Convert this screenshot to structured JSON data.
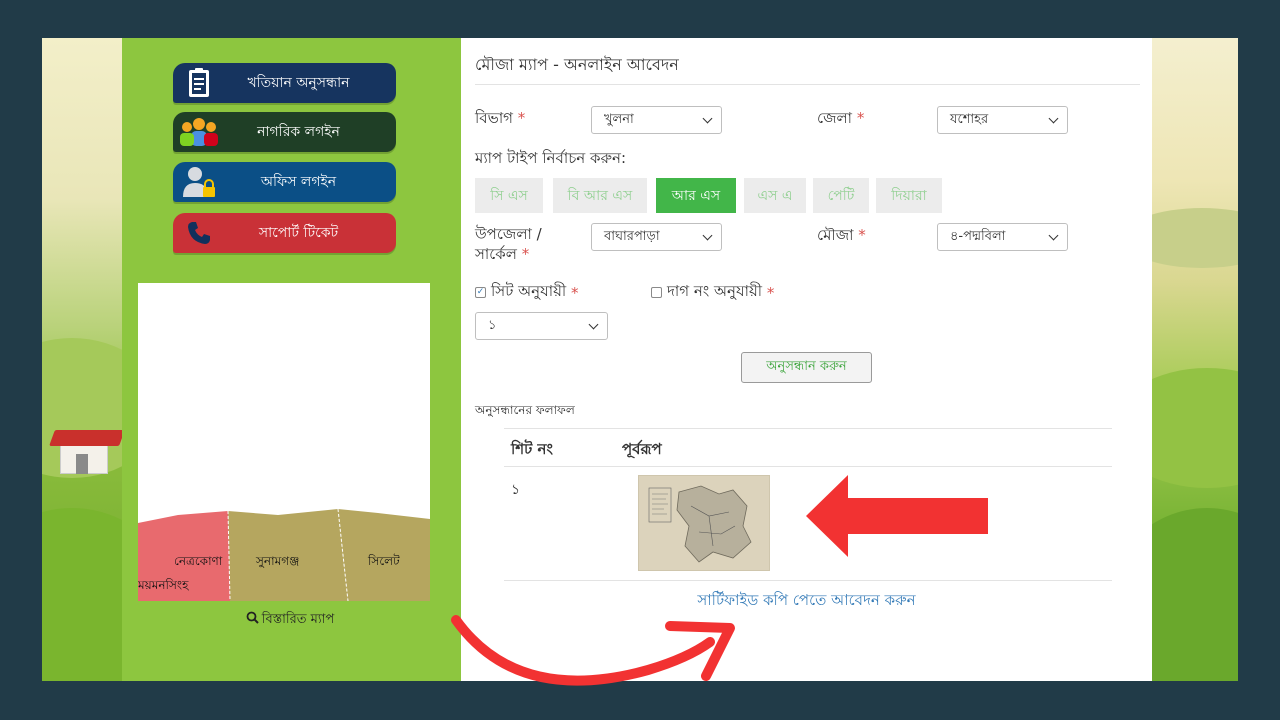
{
  "sidebar": {
    "nav": [
      {
        "label": "খতিয়ান অনুসন্ধান",
        "icon": "clipboard-icon",
        "color": "#16345f"
      },
      {
        "label": "নাগরিক লগইন",
        "icon": "users-icon",
        "color": "#1f3f26"
      },
      {
        "label": "অফিস লগইন",
        "icon": "user-lock-icon",
        "color": "#0b4f86"
      },
      {
        "label": "সাপোর্ট টিকেট",
        "icon": "phone-icon",
        "color": "#c93137"
      }
    ],
    "map": {
      "districts": [
        "নেত্রকোণা",
        "সুনামগঞ্জ",
        "সিলেট",
        "ময়মনসিংহ"
      ],
      "link_label": "বিস্তারিত ম্যাপ",
      "link_icon": "search-icon"
    }
  },
  "main": {
    "title": "মৌজা ম্যাপ - অনলাইন আবেদন",
    "division": {
      "label": "বিভাগ",
      "value": "খুলনা"
    },
    "district": {
      "label": "জেলা",
      "value": "যশোহর"
    },
    "map_type_label": "ম্যাপ টাইপ নির্বাচন করুন:",
    "map_types": [
      {
        "label": "সি এস",
        "active": false
      },
      {
        "label": "বি আর এস",
        "active": false
      },
      {
        "label": "আর এস",
        "active": true
      },
      {
        "label": "এস এ",
        "active": false
      },
      {
        "label": "পেটি",
        "active": false
      },
      {
        "label": "দিয়ারা",
        "active": false
      }
    ],
    "upazila": {
      "label_line1": "উপজেলা /",
      "label_line2": "সার্কেল",
      "value": "বাঘারপাড়া"
    },
    "mouza": {
      "label": "মৌজা",
      "value": "৪-পদ্মবিলা"
    },
    "required_mark": "*",
    "sheet_option": {
      "label": "সিট অনুযায়ী",
      "checked": true
    },
    "dag_option": {
      "label": "দাগ নং অনুযায়ী",
      "checked": false
    },
    "sheet_select": {
      "value": "১"
    },
    "search_button": "অনুসন্ধান করুন",
    "results_label": "অনুসন্ধানের ফলাফল",
    "table": {
      "headers": [
        "শিট নং",
        "পূর্বরূপ"
      ],
      "rows": [
        {
          "sheet_no": "১"
        }
      ]
    },
    "apply_link": "সার্টিফাইড কপি পেতে আবেদন করুন"
  },
  "annotations": {
    "arrow_color": "#f23232"
  }
}
